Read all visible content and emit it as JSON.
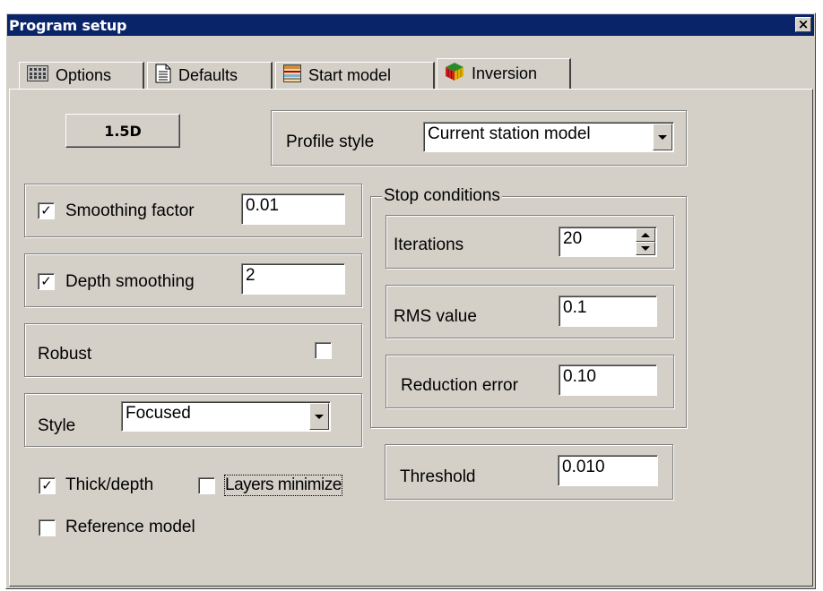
{
  "window": {
    "title": "Program setup",
    "close_glyph": "×"
  },
  "tabs": [
    {
      "label": "Options",
      "icon": "calculator-icon",
      "active": false
    },
    {
      "label": "Defaults",
      "icon": "document-icon",
      "active": false
    },
    {
      "label": "Start model",
      "icon": "layers-icon",
      "active": false
    },
    {
      "label": "Inversion",
      "icon": "cube-icon",
      "active": true
    }
  ],
  "inversion": {
    "mode_button": "1.5D",
    "profile_style": {
      "label": "Profile style",
      "value": "Current station model"
    },
    "smoothing_factor": {
      "label": "Smoothing factor",
      "checked": true,
      "value": "0.01"
    },
    "depth_smoothing": {
      "label": "Depth smoothing",
      "checked": true,
      "value": "2"
    },
    "robust": {
      "label": "Robust",
      "checked": false
    },
    "style": {
      "label": "Style",
      "value": "Focused"
    },
    "thick_depth": {
      "label": "Thick/depth",
      "checked": true
    },
    "layers_minimize": {
      "label": "Layers minimize",
      "checked": false
    },
    "reference_model": {
      "label": "Reference model",
      "checked": false
    },
    "stop_conditions": {
      "title": "Stop conditions",
      "iterations": {
        "label": "Iterations",
        "value": "20"
      },
      "rms_value": {
        "label": "RMS value",
        "value": "0.1"
      },
      "reduction_error": {
        "label": "Reduction error",
        "value": "0.10"
      }
    },
    "threshold": {
      "label": "Threshold",
      "value": "0.010"
    }
  },
  "check_glyph": "✓",
  "colors": {
    "titlebar": "#0a246a",
    "face": "#d4d0c8",
    "shadow": "#808080",
    "highlight": "#ffffff"
  }
}
